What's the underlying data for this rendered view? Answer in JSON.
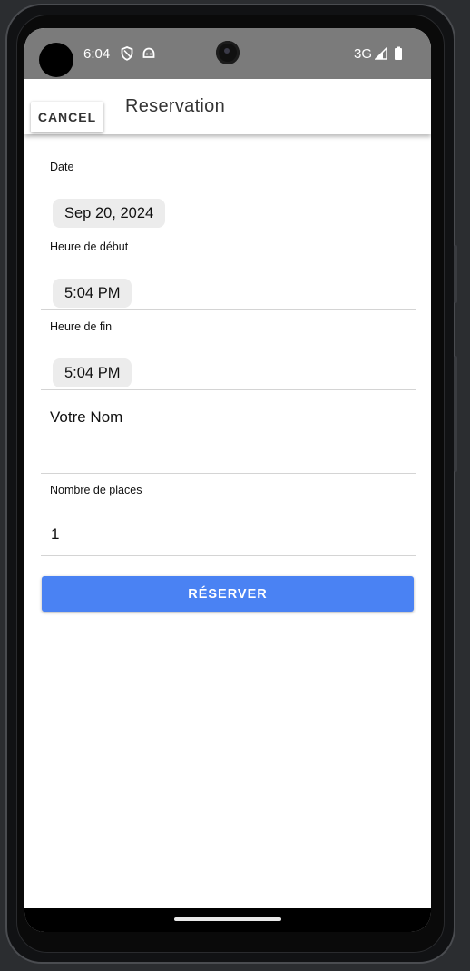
{
  "status_bar": {
    "time": "6:04",
    "network": "3G"
  },
  "app_bar": {
    "cancel_label": "CANCEL",
    "title": "Reservation"
  },
  "form": {
    "date": {
      "label": "Date",
      "value": "Sep 20, 2024"
    },
    "start_time": {
      "label": "Heure de début",
      "value": "5:04 PM"
    },
    "end_time": {
      "label": "Heure de fin",
      "value": "5:04 PM"
    },
    "name": {
      "value": "Votre Nom"
    },
    "places": {
      "label": "Nombre de places",
      "value": "1"
    },
    "submit_label": "RÉSERVER"
  },
  "colors": {
    "primary_button": "#4a82f3",
    "status_bar": "#7b7b7b",
    "chip_background": "#ececec"
  },
  "icons": {
    "status_left": [
      "shield-icon",
      "android-icon"
    ],
    "status_right": [
      "signal-icon",
      "battery-icon"
    ]
  }
}
